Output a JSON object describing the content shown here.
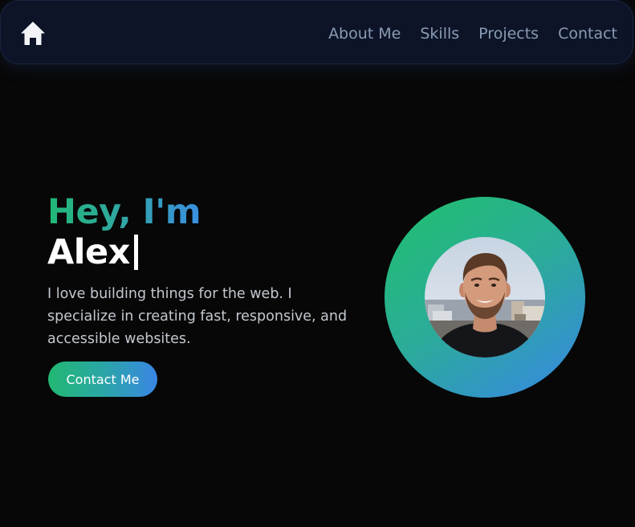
{
  "nav": {
    "home_icon": "home-icon",
    "links": [
      {
        "label": "About Me"
      },
      {
        "label": "Skills"
      },
      {
        "label": "Projects"
      },
      {
        "label": "Contact"
      }
    ]
  },
  "hero": {
    "greeting": "Hey, I'm",
    "name": "Alex",
    "description": "I love building things for the web. I specialize in creating fast, responsive, and accessible websites.",
    "cta_label": "Contact Me"
  },
  "colors": {
    "background": "#070707",
    "nav_background": "#0d1428",
    "nav_link": "#8a9bb4",
    "gradient_start": "#22b872",
    "gradient_end": "#3a86e4"
  }
}
